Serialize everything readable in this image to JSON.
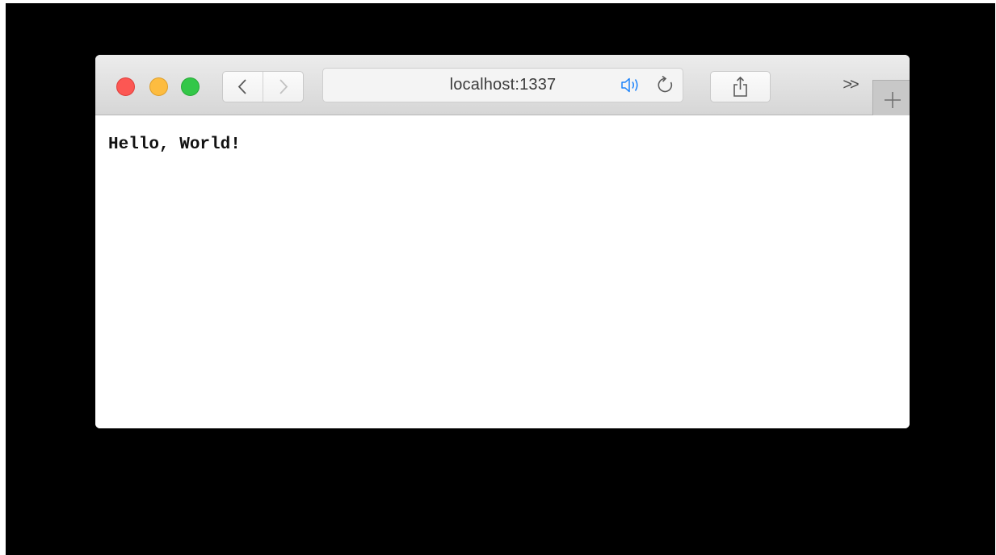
{
  "browser": {
    "traffic_lights": {
      "close_color": "#fc5753",
      "minimize_color": "#fdbc40",
      "zoom_color": "#33c748"
    },
    "toolbar": {
      "back_icon": "chevron-left-icon",
      "forward_icon": "chevron-right-icon",
      "address": {
        "text": "localhost:1337",
        "audio_icon": "speaker-icon",
        "reload_icon": "reload-icon"
      },
      "share_icon": "share-icon",
      "overflow_label": ">>",
      "new_tab_icon": "plus-icon"
    },
    "accent_color": "#1a82fb"
  },
  "page": {
    "text": "Hello, World!"
  }
}
